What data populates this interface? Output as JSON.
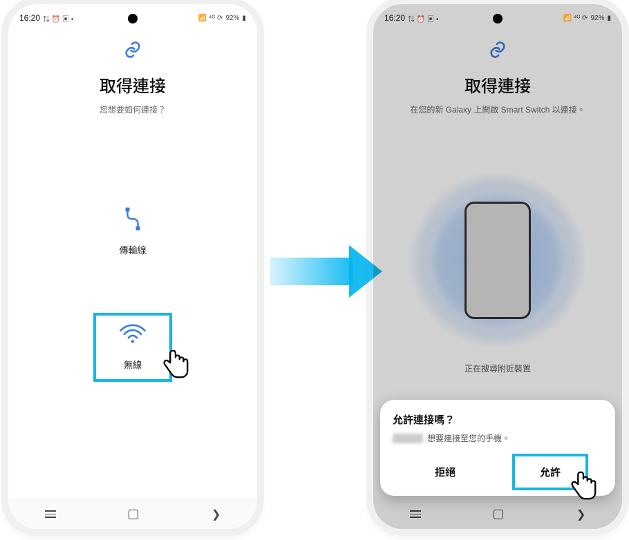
{
  "status": {
    "time": "16:20",
    "battery_text": "92%"
  },
  "left": {
    "title": "取得連接",
    "subtitle": "您想要如何連接？",
    "option_cable": "傳輸線",
    "option_wireless": "無線"
  },
  "right": {
    "title": "取得連接",
    "subtitle": "在您的新 Galaxy 上開啟 Smart Switch 以連接。",
    "searching": "正在搜尋附近裝置"
  },
  "dialog": {
    "title": "允許連接嗎？",
    "message_suffix": "想要連接至您的手機。",
    "deny": "拒絕",
    "allow": "允許"
  }
}
